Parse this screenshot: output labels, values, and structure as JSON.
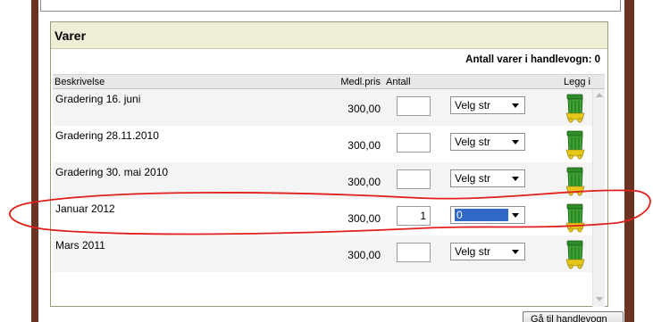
{
  "panel": {
    "title": "Varer",
    "cart_count_label": "Antall varer i handlevogn: 0"
  },
  "table": {
    "headers": {
      "description": "Beskrivelse",
      "price": "Medl.pris",
      "quantity": "Antall",
      "size": "",
      "add": "Legg i"
    },
    "rows": [
      {
        "description": "Gradering 16. juni",
        "price": "300,00",
        "quantity": "",
        "size": "Velg str"
      },
      {
        "description": "Gradering 28.11.2010",
        "price": "300,00",
        "quantity": "",
        "size": "Velg str"
      },
      {
        "description": "Gradering 30. mai 2010",
        "price": "300,00",
        "quantity": "",
        "size": "Velg str"
      },
      {
        "description": "Januar 2012",
        "price": "300,00",
        "quantity": "1",
        "size": "0"
      },
      {
        "description": "Mars 2011",
        "price": "300,00",
        "quantity": "",
        "size": "Velg str"
      }
    ]
  },
  "footer": {
    "go_to_cart_label": "Gå til handlevogn"
  },
  "icons": {
    "add_to_cart": "green-trash-bin-icon",
    "dropdown": "chevron-down-icon"
  },
  "colors": {
    "frame_brown": "#6b3322",
    "header_bg": "#efefd8",
    "highlight_blue": "#3169c6",
    "annotation_red": "#e0201b",
    "bin_green": "#2f8c2a",
    "bin_yellow": "#e6c619"
  }
}
